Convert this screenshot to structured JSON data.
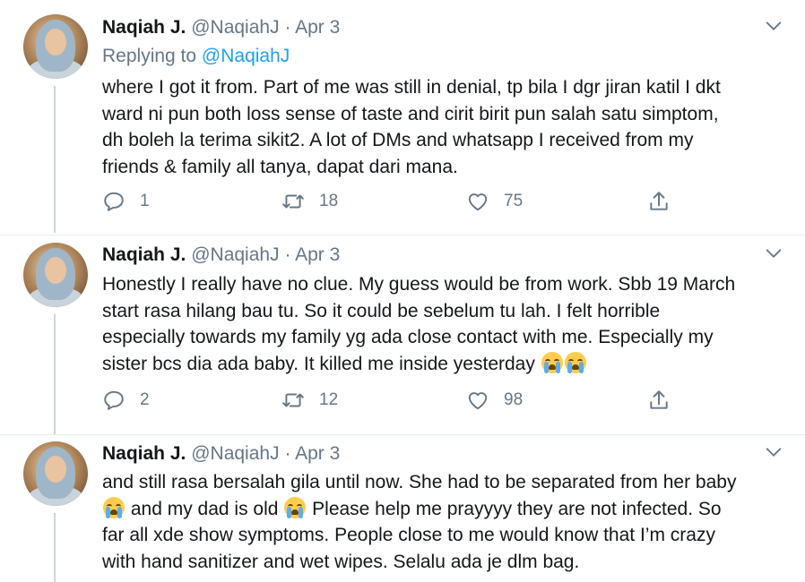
{
  "tweets": [
    {
      "name": "Naqiah J.",
      "handle": "@NaqiahJ",
      "dot": "·",
      "date": "Apr 3",
      "replying_prefix": "Replying to",
      "replying_to": "@NaqiahJ",
      "lines": [
        "where I got it from. Part of me was still in denial, tp bila I dgr jiran katil I dkt",
        "ward ni pun both loss sense of taste and cirit birit pun salah satu simptom,",
        "dh boleh la terima sikit2. A lot of DMs and whatsapp I received from my",
        "friends & family all tanya, dapat dari mana."
      ],
      "replies": "1",
      "retweets": "18",
      "likes": "75"
    },
    {
      "name": "Naqiah J.",
      "handle": "@NaqiahJ",
      "dot": "·",
      "date": "Apr 3",
      "lines": [
        "Honestly I really have no clue. My guess would be from work. Sbb 19 March",
        "start rasa hilang bau tu. So it could be sebelum tu lah. I felt horrible",
        "especially towards my family yg ada close contact with me. Especially my",
        "sister bcs dia ada baby. It killed me inside yesterday"
      ],
      "replies": "2",
      "retweets": "12",
      "likes": "98"
    },
    {
      "name": "Naqiah J.",
      "handle": "@NaqiahJ",
      "dot": "·",
      "date": "Apr 3",
      "line1": "and still rasa bersalah gila until now. She had to be separated from her baby",
      "line2a": "and my dad is old",
      "line2b": "Please help me prayyyy they are not infected. So",
      "line3": "far all xde show symptoms. People close to me would know that I’m crazy",
      "line4": "with hand sanitizer and wet wipes. Selalu ada je dlm bag."
    }
  ],
  "icons": {
    "avatar": "profile-photo",
    "more": "chevron-down-icon",
    "reply": "reply-icon",
    "retweet": "retweet-icon",
    "like": "heart-icon",
    "share": "share-icon",
    "emoji": "loudly-crying-face"
  },
  "colors": {
    "text": "#14171a",
    "secondary": "#657786",
    "link": "#1da1f2",
    "thread_line": "#ccd6dd"
  }
}
